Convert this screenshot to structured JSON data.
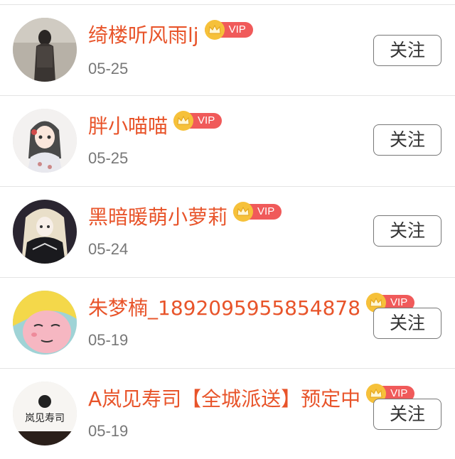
{
  "follow_list": {
    "items": [
      {
        "name": "绮楼听风雨lj",
        "badge": "VIP",
        "date": "05-25",
        "follow_label": "关注",
        "avatar_icon": "girl-photo-avatar"
      },
      {
        "name": "胖小喵喵",
        "badge": "VIP",
        "date": "05-25",
        "follow_label": "关注",
        "avatar_icon": "anime-girl-avatar"
      },
      {
        "name": "黑暗暖萌小萝莉",
        "badge": "VIP",
        "date": "05-24",
        "follow_label": "关注",
        "avatar_icon": "gothic-doll-avatar"
      },
      {
        "name": "朱梦楠_18920959558548​78",
        "badge": "VIP",
        "date": "05-19",
        "follow_label": "关注",
        "avatar_icon": "cartoon-face-avatar"
      },
      {
        "name": "A岚见寿司【全城派送】预定中",
        "badge": "VIP",
        "date": "05-19",
        "follow_label": "关注",
        "avatar_icon": "sushi-logo-avatar",
        "avatar_text": "岚见寿司"
      }
    ]
  },
  "colors": {
    "name": "#e8542a",
    "vip_bg": "#f05a5a",
    "crown": "#f6c13a",
    "date": "#777777"
  }
}
